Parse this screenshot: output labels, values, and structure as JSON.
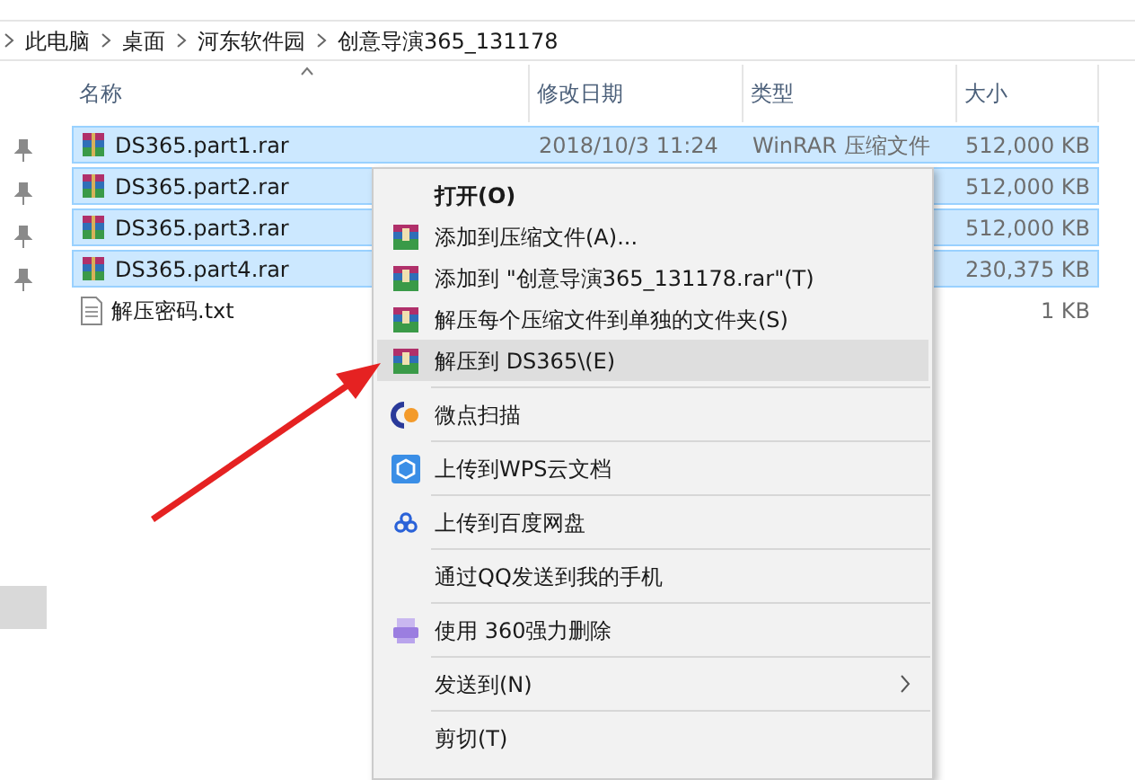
{
  "breadcrumb": [
    "此电脑",
    "桌面",
    "河东软件园",
    "创意导演365_131178"
  ],
  "columns": [
    {
      "label": "名称",
      "sorted": true
    },
    {
      "label": "修改日期",
      "sorted": false
    },
    {
      "label": "类型",
      "sorted": false
    },
    {
      "label": "大小",
      "sorted": false
    }
  ],
  "files": [
    {
      "name": "DS365.part1.rar",
      "kind": "rar",
      "modified": "2018/10/3 11:24",
      "type": "WinRAR 压缩文件",
      "size": "512,000 KB",
      "selected": true
    },
    {
      "name": "DS365.part2.rar",
      "kind": "rar",
      "size": "512,000 KB",
      "selected": true
    },
    {
      "name": "DS365.part3.rar",
      "kind": "rar",
      "size": "512,000 KB",
      "selected": true
    },
    {
      "name": "DS365.part4.rar",
      "kind": "rar",
      "size": "230,375 KB",
      "selected": true
    },
    {
      "name": "解压密码.txt",
      "kind": "txt",
      "size": "1 KB",
      "selected": false
    }
  ],
  "context_menu": {
    "groups": [
      [
        {
          "label": "打开(O)",
          "default": true,
          "selected": false
        },
        {
          "label": "添加到压缩文件(A)...",
          "default": false,
          "selected": false
        },
        {
          "label": "添加到 \"创意导演365_131178.rar\"(T)",
          "default": false,
          "selected": false
        },
        {
          "label": "解压每个压缩文件到单独的文件夹(S)",
          "default": false,
          "selected": false
        },
        {
          "label": "解压到 DS365\\(E)",
          "default": false,
          "selected": true
        }
      ],
      [
        {
          "label": "微点扫描",
          "default": false,
          "selected": false
        }
      ],
      [
        {
          "label": "上传到WPS云文档",
          "default": false,
          "selected": false
        }
      ],
      [
        {
          "label": "上传到百度网盘",
          "default": false,
          "selected": false
        }
      ],
      [
        {
          "label": "通过QQ发送到我的手机",
          "default": false,
          "selected": false
        }
      ],
      [
        {
          "label": "使用 360强力删除",
          "default": false,
          "selected": false
        }
      ],
      [
        {
          "label": "发送到(N)",
          "default": false,
          "selected": false,
          "submenu": true
        }
      ],
      [
        {
          "label": "剪切(T)",
          "default": false,
          "selected": false
        }
      ]
    ]
  }
}
